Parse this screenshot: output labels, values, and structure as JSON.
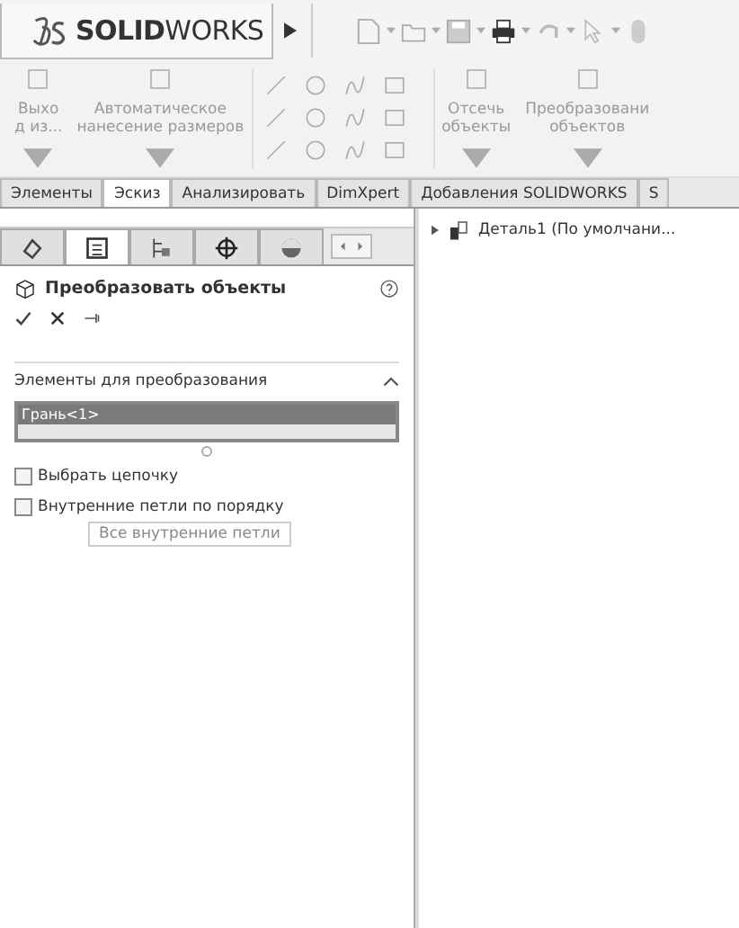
{
  "app": {
    "logo_prefix": "SOLID",
    "logo_suffix": "WORKS"
  },
  "ribbon": [
    {
      "kind": "big",
      "lines": [
        "Выхо",
        "д из..."
      ]
    },
    {
      "kind": "big",
      "lines": [
        "Автоматическое",
        "нанесение размеров"
      ]
    },
    {
      "kind": "sketch_tools"
    },
    {
      "kind": "big",
      "lines": [
        "Отсечь",
        "объекты"
      ]
    },
    {
      "kind": "big",
      "lines": [
        "Преобразовани",
        "объектов"
      ]
    }
  ],
  "tabs": [
    {
      "label": "Элементы",
      "selected": false
    },
    {
      "label": "Эскиз",
      "selected": true
    },
    {
      "label": "Анализировать",
      "selected": false
    },
    {
      "label": "DimXpert",
      "selected": false
    },
    {
      "label": "Добавления SOLIDWORKS",
      "selected": false
    },
    {
      "label": "S",
      "selected": false
    }
  ],
  "panel_tabs": [
    {
      "selected": false
    },
    {
      "selected": true
    },
    {
      "selected": false
    },
    {
      "selected": false
    },
    {
      "selected": false
    }
  ],
  "property_manager": {
    "title": "Преобразовать объекты",
    "section": {
      "title": "Элементы для преобразования",
      "expanded": true,
      "items": [
        {
          "label": "Грань<1>",
          "selected": true
        }
      ]
    },
    "options": [
      {
        "label": "Выбрать цепочку",
        "checked": false
      },
      {
        "label": "Внутренние петли по порядку",
        "checked": false
      }
    ],
    "button": {
      "label": "Все внутренние петли",
      "disabled": true
    }
  },
  "tree": [
    {
      "label": "Деталь1  (По умолчани...",
      "expanded": false
    }
  ]
}
